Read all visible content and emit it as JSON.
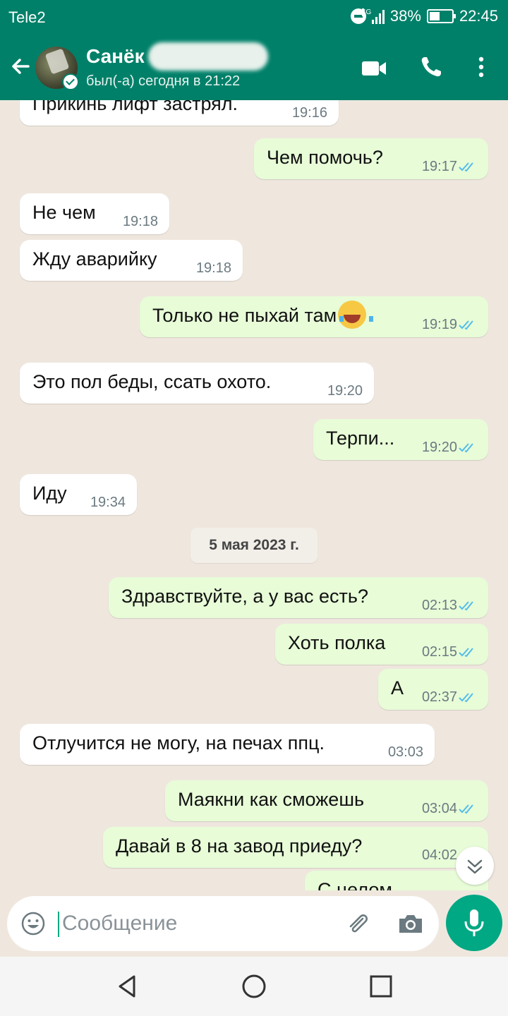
{
  "status_bar": {
    "carrier": "Tele2",
    "network": "4G",
    "battery": "38%",
    "time": "22:45"
  },
  "header": {
    "contact_name": "Санёк",
    "last_seen": "был(-а) сегодня в 21:22"
  },
  "chat": {
    "date_separator": "5 мая 2023 г.",
    "messages": [
      {
        "dir": "in",
        "text": "Прикинь лифт застрял.",
        "time": "19:16"
      },
      {
        "dir": "out",
        "text": "Чем помочь?",
        "time": "19:17",
        "status": "read"
      },
      {
        "dir": "in",
        "text": "Не чем",
        "time": "19:18"
      },
      {
        "dir": "in",
        "text": "Жду аварийку",
        "time": "19:18"
      },
      {
        "dir": "out",
        "text": "Только не пыхай там",
        "emoji": "face-with-tears-of-joy",
        "time": "19:19",
        "status": "read"
      },
      {
        "dir": "in",
        "text": "Это пол беды, ссать охото.",
        "time": "19:20"
      },
      {
        "dir": "out",
        "text": "Терпи...",
        "time": "19:20",
        "status": "read"
      },
      {
        "dir": "in",
        "text": "Иду",
        "time": "19:34"
      },
      {
        "dir": "out",
        "text": "Здравствуйте, а у вас есть?",
        "time": "02:13",
        "status": "read"
      },
      {
        "dir": "out",
        "text": "Хоть полка",
        "time": "02:15",
        "status": "read"
      },
      {
        "dir": "out",
        "text": "А",
        "time": "02:37",
        "status": "read"
      },
      {
        "dir": "in",
        "text": "Отлучится не могу, на печах ппц.",
        "time": "03:03"
      },
      {
        "dir": "out",
        "text": "Маякни как сможешь",
        "time": "03:04",
        "status": "read"
      },
      {
        "dir": "out",
        "text": "Давай в 8 на завод приеду?",
        "time": "04:02",
        "status": "read"
      },
      {
        "dir": "out",
        "text": "С целом",
        "time": "",
        "status": ""
      }
    ]
  },
  "composer": {
    "placeholder": "Сообщение"
  },
  "colors": {
    "primary": "#008069",
    "accent": "#00a884",
    "outgoing_bubble": "#e7fcd7",
    "incoming_bubble": "#ffffff",
    "read_ticks": "#53bdeb"
  }
}
